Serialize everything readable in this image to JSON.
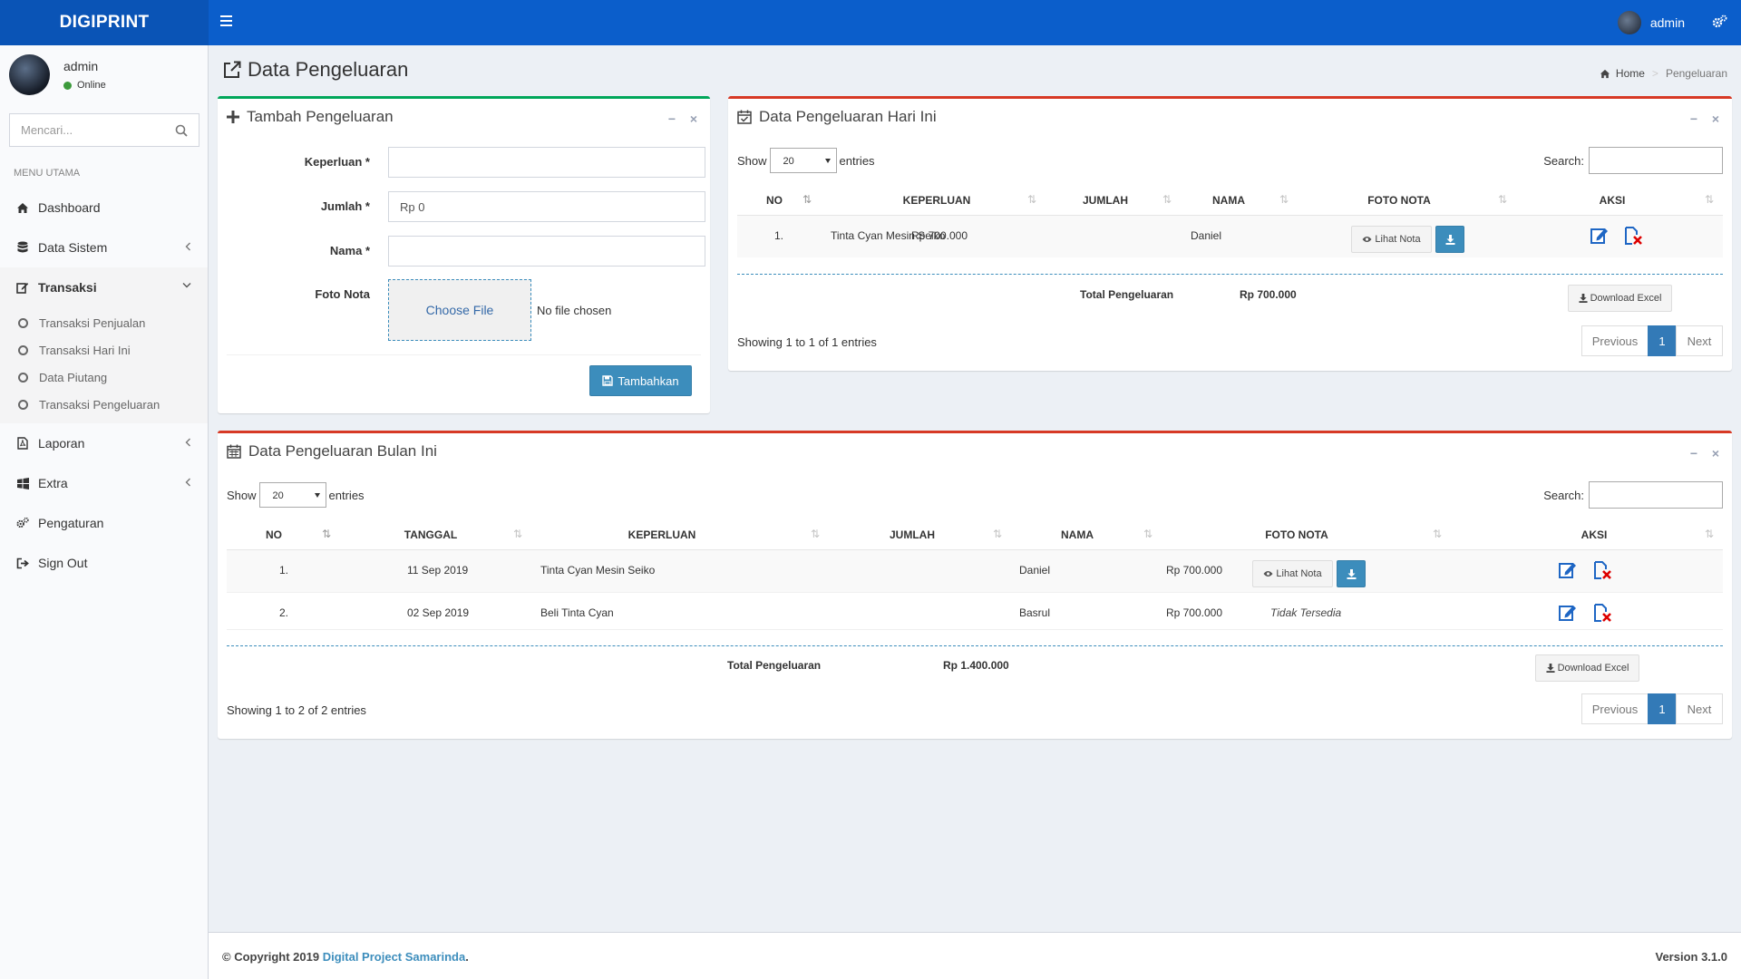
{
  "header": {
    "brand": "DIGIPRINT",
    "user_name": "admin"
  },
  "sidebar": {
    "user_name": "admin",
    "status": "Online",
    "search_placeholder": "Mencari...",
    "menu_header": "MENU UTAMA",
    "items": [
      {
        "label": "Dashboard"
      },
      {
        "label": "Data Sistem"
      },
      {
        "label": "Transaksi"
      },
      {
        "label": "Laporan"
      },
      {
        "label": "Extra"
      },
      {
        "label": "Pengaturan"
      },
      {
        "label": "Sign Out"
      }
    ],
    "sub_items": [
      {
        "label": "Transaksi Penjualan"
      },
      {
        "label": "Transaksi Hari Ini"
      },
      {
        "label": "Data Piutang"
      },
      {
        "label": "Transaksi Pengeluaran"
      }
    ]
  },
  "page": {
    "title": "Data Pengeluaran",
    "breadcrumb": {
      "home": "Home",
      "current": "Pengeluaran"
    }
  },
  "form": {
    "title": "Tambah Pengeluaran",
    "keperluan_label": "Keperluan *",
    "keperluan_value": "",
    "jumlah_label": "Jumlah *",
    "jumlah_value": "Rp 0",
    "nama_label": "Nama *",
    "nama_value": "",
    "foto_label": "Foto Nota",
    "file_button": "Choose File",
    "file_status": "No file chosen",
    "submit_label": "Tambahkan"
  },
  "today": {
    "title": "Data Pengeluaran Hari Ini",
    "show_label": "Show",
    "entries_value": "20",
    "entries_label": "entries",
    "search_label": "Search:",
    "columns": [
      "NO",
      "KEPERLUAN",
      "JUMLAH",
      "NAMA",
      "FOTO NOTA",
      "AKSI"
    ],
    "rows": [
      {
        "no": "1.",
        "keperluan": "Tinta Cyan Mesin Seiko",
        "jumlah": "Rp 700.000",
        "nama": "Daniel",
        "nota_label": "Lihat Nota"
      }
    ],
    "total_label": "Total Pengeluaran",
    "total_value": "Rp 700.000",
    "download_label": "Download Excel",
    "info": "Showing 1 to 1 of 1 entries",
    "pager": {
      "prev": "Previous",
      "page": "1",
      "next": "Next"
    }
  },
  "month": {
    "title": "Data Pengeluaran Bulan Ini",
    "show_label": "Show",
    "entries_value": "20",
    "entries_label": "entries",
    "search_label": "Search:",
    "columns": [
      "NO",
      "TANGGAL",
      "KEPERLUAN",
      "JUMLAH",
      "NAMA",
      "FOTO NOTA",
      "AKSI"
    ],
    "rows": [
      {
        "no": "1.",
        "tanggal": "11 Sep 2019",
        "keperluan": "Tinta Cyan Mesin Seiko",
        "jumlah": "Rp 700.000",
        "nama": "Daniel",
        "nota_label": "Lihat Nota"
      },
      {
        "no": "2.",
        "tanggal": "02 Sep 2019",
        "keperluan": "Beli Tinta Cyan",
        "jumlah": "Rp 700.000",
        "nama": "Basrul",
        "nota_label": "Tidak Tersedia"
      }
    ],
    "total_label": "Total Pengeluaran",
    "total_value": "Rp 1.400.000",
    "download_label": "Download Excel",
    "info": "Showing 1 to 2 of 2 entries",
    "pager": {
      "prev": "Previous",
      "page": "1",
      "next": "Next"
    }
  },
  "footer": {
    "copyright_prefix": "© Copyright 2019 ",
    "company": "Digital Project Samarinda",
    "copyright_suffix": ".",
    "version": "Version 3.1.0"
  }
}
